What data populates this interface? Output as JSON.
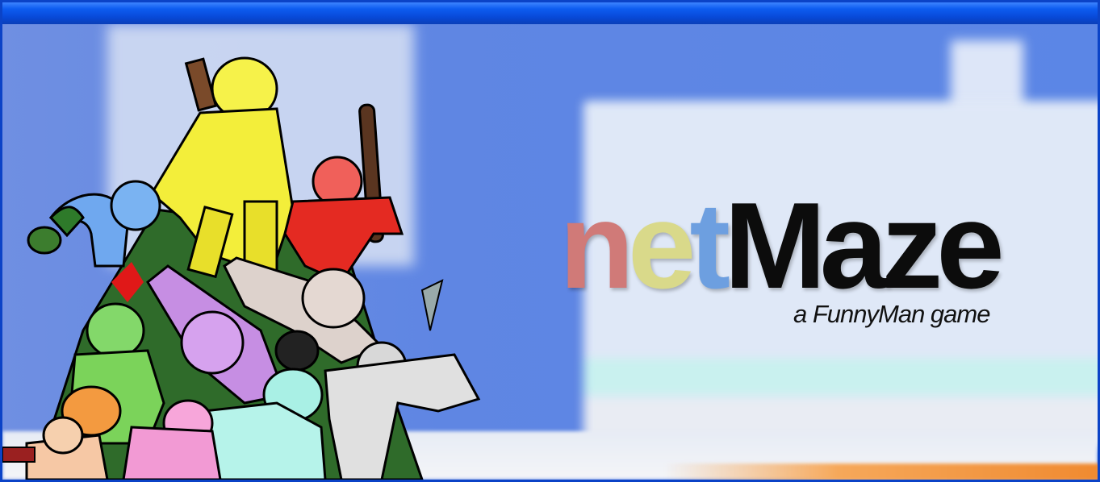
{
  "window": {
    "titlebar_color": "#0a4fd8"
  },
  "splash": {
    "logo": {
      "n": "n",
      "e": "e",
      "t": "t",
      "rest": "Maze"
    },
    "tagline": "a FunnyMan game",
    "colors": {
      "n": "#d07a78",
      "e": "#d9d98a",
      "t": "#6d9fe0",
      "rest": "#0c0c0c"
    },
    "artwork": "pile-of-cartoon-characters"
  }
}
